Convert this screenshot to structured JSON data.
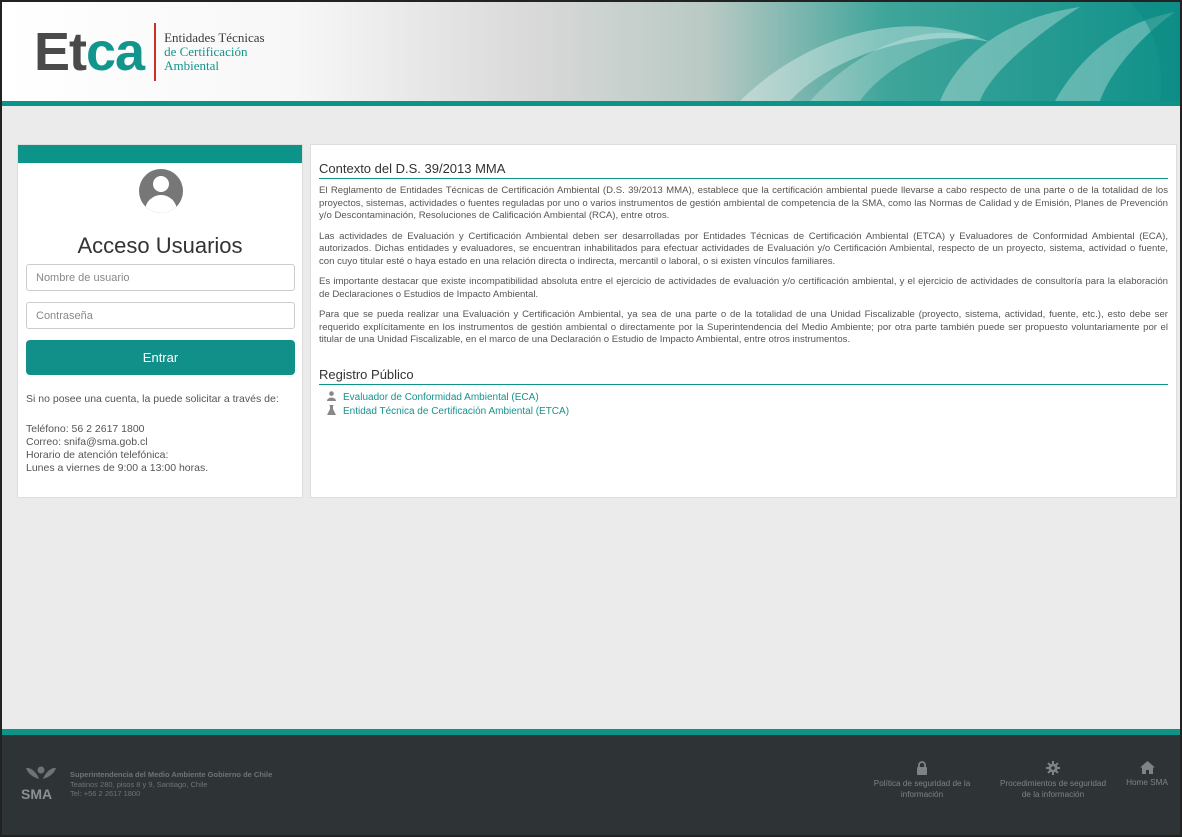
{
  "header": {
    "logo_main": "Et",
    "logo_accent": "ca",
    "logo_line1": "Entidades Técnicas",
    "logo_line2": "de Certificación",
    "logo_line3": "Ambiental"
  },
  "login": {
    "title": "Acceso Usuarios",
    "username_placeholder": "Nombre de usuario",
    "password_placeholder": "Contraseña",
    "submit_label": "Entrar",
    "request_text": "Si no posee una cuenta, la puede solicitar a través de:",
    "phone": "Teléfono: 56 2 2617 1800",
    "email": "Correo: snifa@sma.gob.cl",
    "hours_label": "Horario de atención telefónica:",
    "hours": "Lunes a viernes de 9:00 a 13:00 horas."
  },
  "main": {
    "context_title": "Contexto del D.S. 39/2013 MMA",
    "paragraphs": [
      "El Reglamento de Entidades Técnicas de Certificación Ambiental (D.S. 39/2013 MMA), establece que la certificación ambiental puede llevarse a cabo respecto de una parte o de la totalidad de los proyectos, sistemas, actividades o fuentes reguladas por uno o varios instrumentos de gestión ambiental de competencia de la SMA, como las Normas de Calidad y de Emisión, Planes de Prevención y/o Descontaminación, Resoluciones de Calificación Ambiental (RCA), entre otros.",
      "Las actividades de Evaluación y Certificación Ambiental deben ser desarrolladas por Entidades Técnicas de Certificación Ambiental (ETCA) y Evaluadores de Conformidad Ambiental (ECA), autorizados. Dichas entidades y evaluadores, se encuentran inhabilitados para efectuar actividades de Evaluación y/o Certificación Ambiental, respecto de un proyecto, sistema, actividad o fuente, con cuyo titular esté o haya estado en una relación directa o indirecta, mercantil o laboral, o si existen vínculos familiares.",
      "Es importante destacar que existe incompatibilidad absoluta entre el ejercicio de actividades de evaluación y/o certificación ambiental, y el ejercicio de actividades de consultoría para la elaboración de Declaraciones o Estudios de Impacto Ambiental.",
      "Para que se pueda realizar una Evaluación y Certificación Ambiental, ya sea de una parte o de la totalidad de una Unidad Fiscalizable (proyecto, sistema, actividad, fuente, etc.), esto debe ser requerido explícitamente en los instrumentos de gestión ambiental o directamente por la Superintendencia del Medio Ambiente; por otra parte también puede ser propuesto voluntariamente por el titular de una Unidad Fiscalizable, en el marco de una Declaración o Estudio de Impacto Ambiental, entre otros instrumentos."
    ],
    "registry_title": "Registro Público",
    "registry_links": [
      {
        "label": "Evaluador de Conformidad Ambiental (ECA)",
        "icon": "user-icon"
      },
      {
        "label": "Entidad Técnica de Certificación Ambiental (ETCA)",
        "icon": "flask-icon"
      }
    ]
  },
  "footer": {
    "org_name": "Superintendencia del Medio Ambiente Gobierno de Chile",
    "address": "Teatinos 280, pisos 8 y 9, Santiago, Chile",
    "phone": "Tel: +56 2 2617 1800",
    "sma_label": "SMA",
    "links": [
      {
        "line1": "Política de seguridad de la",
        "line2": "información",
        "icon": "lock-icon"
      },
      {
        "line1": "Procedimientos de seguridad",
        "line2": "de la información",
        "icon": "gear-icon"
      },
      {
        "line1": "Home SMA",
        "line2": "",
        "icon": "home-icon"
      }
    ]
  },
  "colors": {
    "accent": "#0d9488",
    "button": "#119089",
    "footer_bg": "#2e3336",
    "logo_accent": "#12958c"
  }
}
